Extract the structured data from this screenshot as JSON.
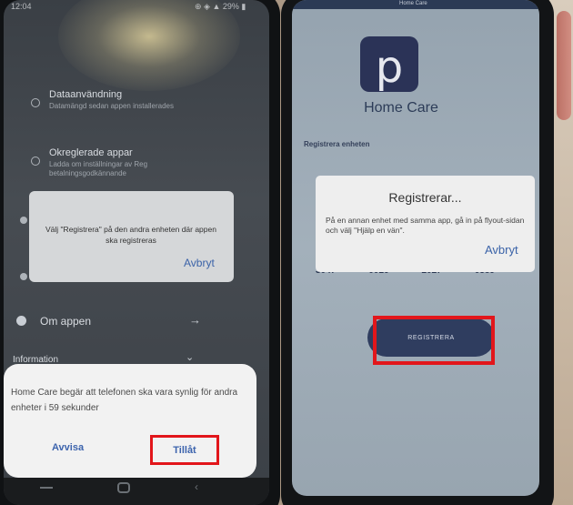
{
  "left_screen": {
    "status_time": "12:04",
    "status_icons": "⊕ ◈ ▲ 29% ▮",
    "settings": [
      {
        "title": "Dataanvändning",
        "subtitle": "Datamängd sedan appen installerades"
      },
      {
        "title": "Okreglerade appar",
        "subtitle": "Ladda om inställningar av Reg betalningsgodkännande"
      }
    ],
    "about_label": "Om appen",
    "app_info_label": "Information",
    "dialog": {
      "message": "Välj \"Registrera\" på den andra enheten där appen ska registreras",
      "cancel_label": "Avbryt"
    },
    "permission_sheet": {
      "message": "Home Care begär att telefonen ska vara synlig för andra enheter i 59 sekunder",
      "deny_label": "Avvisa",
      "allow_label": "Tillåt"
    }
  },
  "right_screen": {
    "header_text": "Home Care",
    "logo_letter": "p",
    "app_title": "Home Care",
    "section_label": "Registrera enheten",
    "codes": [
      "3047",
      "0016",
      "2027",
      "0589"
    ],
    "dialog": {
      "title": "Registrerar...",
      "message": "På en annan enhet med samma app, gå in på flyout-sidan och välj \"Hjälp en vän\".",
      "cancel_label": "Avbryt"
    },
    "register_button_label": "REGISTRERA"
  },
  "colors": {
    "highlight_red": "#e2161b",
    "link_blue": "#3b63a8",
    "brand_navy": "#2b3357"
  }
}
